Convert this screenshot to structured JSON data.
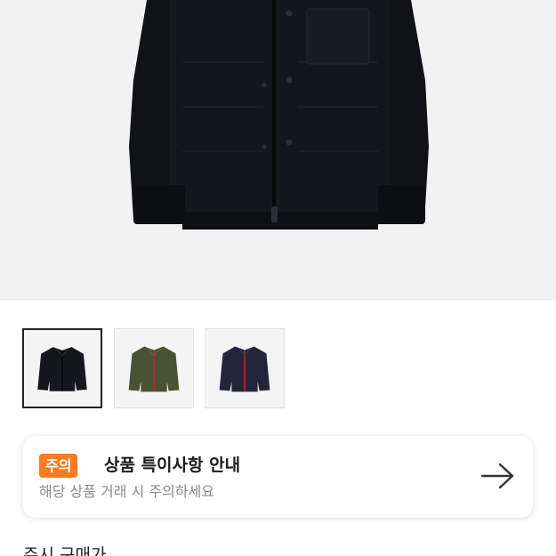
{
  "product": {
    "main_image": {
      "alt": "black-jacket"
    },
    "thumbnails": [
      {
        "name": "thumb-black-jacket",
        "color": "#15171c",
        "selected": true
      },
      {
        "name": "thumb-olive-jacket",
        "color": "#4a5234",
        "selected": false
      },
      {
        "name": "thumb-navy-jacket",
        "color": "#23253a",
        "selected": false
      }
    ]
  },
  "notice": {
    "badge": "주의",
    "title": "상품 특이사항 안내",
    "subtitle": "해당 상품 거래 시 주의하세요",
    "icon": "arrow-right-icon",
    "accent_color": "#ff7a21"
  },
  "section": {
    "label": "주시 구매가"
  }
}
